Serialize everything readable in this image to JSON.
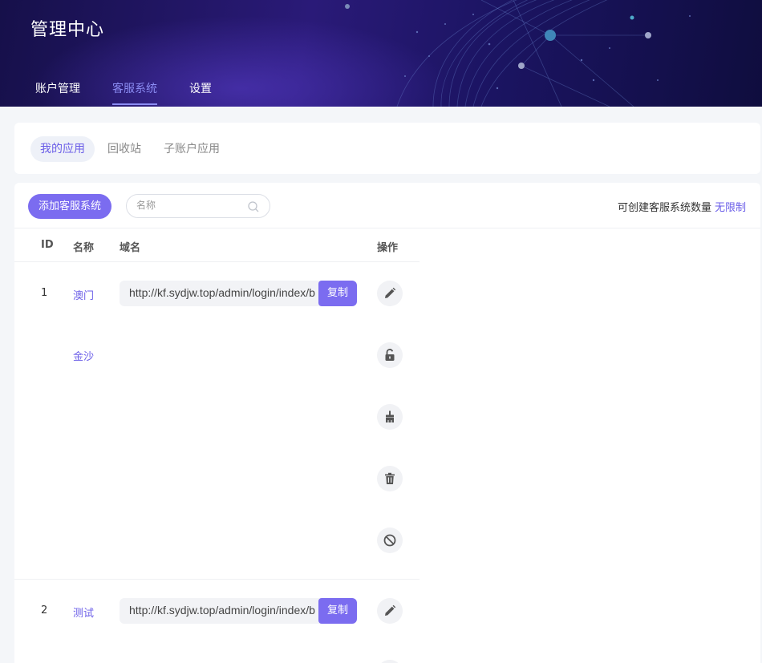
{
  "header": {
    "title": "管理中心",
    "nav": [
      {
        "label": "账户管理",
        "active": false
      },
      {
        "label": "客服系统",
        "active": true
      },
      {
        "label": "设置",
        "active": false
      }
    ]
  },
  "subtabs": [
    {
      "label": "我的应用",
      "active": true
    },
    {
      "label": "回收站",
      "active": false
    },
    {
      "label": "子账户应用",
      "active": false
    }
  ],
  "toolbar": {
    "add_label": "添加客服系统",
    "search_placeholder": "名称",
    "quota_label": "可创建客服系统数量",
    "quota_value": "无限制"
  },
  "table": {
    "columns": [
      "ID",
      "名称",
      "域名",
      "操作"
    ],
    "rows": [
      {
        "id": "1",
        "name": "澳门",
        "name2": "金沙",
        "domain": "http://kf.sydjw.top/admin/login/index/b",
        "copy_label": "复制"
      },
      {
        "id": "2",
        "name": "测试",
        "domain": "http://kf.sydjw.top/admin/login/index/b",
        "copy_label": "复制"
      }
    ],
    "actions": [
      "edit-icon",
      "unlock-icon",
      "clean-icon",
      "delete-icon",
      "disable-icon"
    ]
  },
  "colors": {
    "accent": "#7b6cf0",
    "accent_text": "#6a5de8",
    "header_bg": "#1b1462"
  }
}
